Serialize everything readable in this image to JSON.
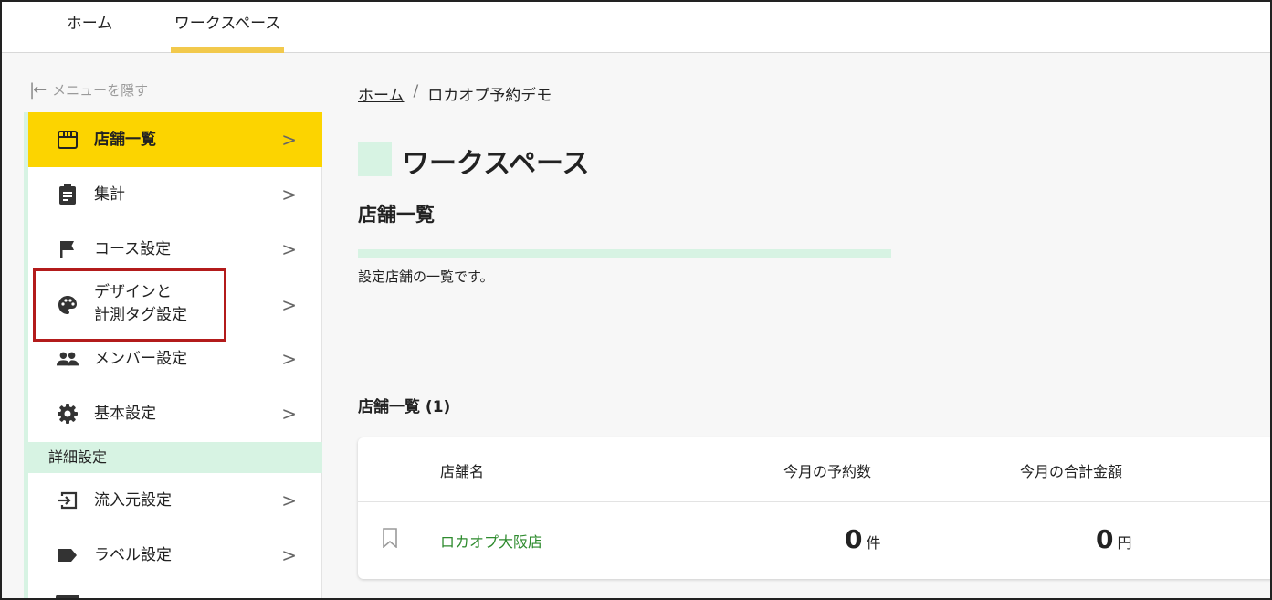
{
  "topnav": {
    "tabs": [
      {
        "label": "ホーム"
      },
      {
        "label": "ワークスペース"
      }
    ]
  },
  "sidebar": {
    "hide_menu_label": "メニューを隠す",
    "items": [
      {
        "label": "店舗一覧",
        "icon": "store-icon"
      },
      {
        "label": "集計",
        "icon": "clipboard-icon"
      },
      {
        "label": "コース設定",
        "icon": "flag-icon"
      },
      {
        "label_line1": "デザインと",
        "label_line2": "計測タグ設定",
        "icon": "palette-icon"
      },
      {
        "label": "メンバー設定",
        "icon": "people-icon"
      },
      {
        "label": "基本設定",
        "icon": "gear-icon"
      }
    ],
    "section_header": "詳細設定",
    "detail_items": [
      {
        "label": "流入元設定",
        "icon": "login-icon"
      },
      {
        "label": "ラベル設定",
        "icon": "label-icon"
      }
    ],
    "chevron": ">"
  },
  "breadcrumb": {
    "home": "ホーム",
    "separator": "/",
    "current": "ロカオプ予約デモ"
  },
  "main": {
    "title": "ワークスペース",
    "subtitle": "店舗一覧",
    "description": "設定店舗の一覧です。",
    "list_title": "店舗一覧 (1)"
  },
  "table": {
    "headers": {
      "name": "店舗名",
      "reservations": "今月の予約数",
      "amount": "今月の合計金額"
    },
    "rows": [
      {
        "name": "ロカオプ大阪店",
        "reservations": "0",
        "reservations_unit": "件",
        "amount": "0",
        "amount_unit": "円"
      }
    ]
  },
  "colors": {
    "accent_yellow": "#fcd400",
    "tab_underline": "#f2c94c",
    "mint": "#d7f3e3",
    "link_green": "#2e8b2e",
    "highlight_red": "#b31b1b"
  }
}
